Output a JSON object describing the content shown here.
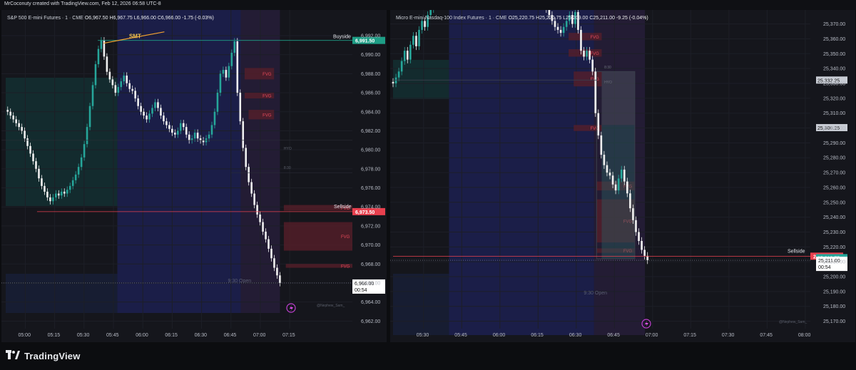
{
  "header": {
    "credit": "MrCoconuty created with TradingView.com, Feb 12, 2026 06:58 UTC-8"
  },
  "brand": {
    "name": "TradingView",
    "logo_icon": "tradingview-logo-icon"
  },
  "colors": {
    "up": "#26a69a",
    "down": "#f0f0f0",
    "buyside": "#1e9e86",
    "sellside": "#e8404e",
    "fvg": "#5a1f2a",
    "smt": "#f0a030",
    "session": "#1e2a66"
  },
  "chart_data": [
    {
      "type": "candlestick",
      "title": "S&P 500 E-mini Futures · 1 · CME",
      "ohlc_header": {
        "O": "6,967.50",
        "H": "6,967.75",
        "L": "6,966.00",
        "C": "6,966.00",
        "change": "-1.75 (-0.03%)"
      },
      "x_ticks": [
        "05:00",
        "05:15",
        "05:30",
        "05:45",
        "06:00",
        "06:15",
        "06:30",
        "06:45",
        "07:00",
        "07:15"
      ],
      "y_ticks": [
        "6,992.00",
        "6,990.00",
        "6,988.00",
        "6,986.00",
        "6,984.00",
        "6,982.00",
        "6,980.00",
        "6,978.00",
        "6,976.00",
        "6,974.00",
        "6,972.00",
        "6,970.00",
        "6,968.00",
        "6,966.00",
        "6,964.00",
        "6,962.00"
      ],
      "ylim": [
        6961.2,
        6993.2
      ],
      "xlim": [
        290,
        467
      ],
      "closes": [
        6984.0,
        6983.6,
        6983.2,
        6982.8,
        6982.4,
        6982.0,
        6981.2,
        6980.4,
        6979.6,
        6978.8,
        6978.0,
        6977.0,
        6976.2,
        6975.6,
        6975.0,
        6974.6,
        6975.0,
        6975.4,
        6975.2,
        6975.6,
        6975.4,
        6975.8,
        6976.2,
        6976.8,
        6977.4,
        6978.2,
        6979.2,
        6980.6,
        6982.4,
        6984.6,
        6986.8,
        6989.0,
        6990.6,
        6991.5,
        6989.8,
        6988.2,
        6987.4,
        6986.8,
        6986.0,
        6986.6,
        6987.2,
        6987.8,
        6987.0,
        6986.4,
        6986.2,
        6985.4,
        6984.6,
        6984.0,
        6983.6,
        6983.2,
        6983.8,
        6984.4,
        6985.0,
        6984.4,
        6983.6,
        6983.0,
        6982.6,
        6982.2,
        6981.8,
        6981.6,
        6982.0,
        6982.8,
        6982.4,
        6981.6,
        6981.0,
        6981.2,
        6981.8,
        6981.2,
        6981.0,
        6980.8,
        6981.2,
        6981.6,
        6982.6,
        6984.0,
        6986.0,
        6988.0,
        6988.4,
        6987.6,
        6988.8,
        6990.2,
        6991.4,
        6986.0,
        6983.0,
        6980.2,
        6978.2,
        6976.6,
        6975.4,
        6974.2,
        6973.2,
        6972.4,
        6971.4,
        6970.6,
        6969.6,
        6968.6,
        6967.6,
        6966.8,
        6966.0
      ],
      "annotations": {
        "smt": "SMT",
        "buyside": "Buyside",
        "sellside": "Sellside",
        "buyside_price": "6,991.50",
        "sellside_price": "6,973.50",
        "last_price": "6,966.00",
        "countdown": "00:54",
        "fvg_label": "FVG",
        "open1": "8:30 Open",
        "open2": "9:30 Open",
        "hyo": "HYO",
        "l830": "8:30",
        "watermark": "@Nephew_Sam_"
      },
      "levels": {
        "buyside": 6991.5,
        "sellside": 6973.5
      },
      "fvgs": [
        {
          "t0": 412,
          "t1": 427,
          "hi": 6988.6,
          "lo": 6987.4
        },
        {
          "t0": 412,
          "t1": 427,
          "hi": 6986.0,
          "lo": 6985.4
        },
        {
          "t0": 414,
          "t1": 427,
          "hi": 6984.2,
          "lo": 6983.2
        },
        {
          "t0": 432,
          "t1": 467,
          "hi": 6974.2,
          "lo": 6973.6
        },
        {
          "t0": 432,
          "t1": 467,
          "hi": 6972.4,
          "lo": 6969.4
        },
        {
          "t0": 433,
          "t1": 467,
          "hi": 6968.0,
          "lo": 6967.6
        }
      ]
    },
    {
      "type": "candlestick",
      "title": "Micro E-mini Nasdaq-100 Index Futures · 1 · CME",
      "ohlc_header": {
        "O": "25,220.75",
        "H": "25,220.75",
        "L": "25,209.00",
        "C": "25,211.00",
        "change": "-9.25 (-0.04%)"
      },
      "x_ticks": [
        "05:30",
        "05:45",
        "06:00",
        "06:15",
        "06:30",
        "06:45",
        "07:00",
        "07:15",
        "07:30",
        "07:45",
        "08:00"
      ],
      "y_ticks": [
        "25,370.00",
        "25,360.00",
        "25,350.00",
        "25,340.00",
        "25,330.00",
        "25,320.00",
        "25,310.00",
        "25,300.00",
        "25,290.00",
        "25,280.00",
        "25,270.00",
        "25,260.00",
        "25,250.00",
        "25,240.00",
        "25,230.00",
        "25,220.00",
        "25,210.00",
        "25,200.00",
        "25,190.00",
        "25,180.00",
        "25,170.00"
      ],
      "ylim": [
        25165.0,
        25377.0
      ],
      "xlim": [
        318,
        482
      ],
      "closes": [
        25330.0,
        25334.0,
        25338.0,
        25345.0,
        25352.0,
        25346.0,
        25356.0,
        25362.0,
        25355.0,
        25366.0,
        25372.0,
        25368.0,
        25376.0,
        25380.0,
        25384.0,
        25388.0,
        25392.0,
        25390.0,
        25388.0,
        25392.0,
        25395.0,
        25393.0,
        25390.0,
        25393.0,
        25396.0,
        25392.0,
        25388.0,
        25390.0,
        25393.0,
        25391.0,
        25389.0,
        25392.0,
        25395.0,
        25392.0,
        25389.0,
        25393.0,
        25397.0,
        25399.0,
        25397.0,
        25394.0,
        25396.0,
        25398.0,
        25395.0,
        25393.0,
        25390.0,
        25388.0,
        25391.0,
        25393.0,
        25390.0,
        25386.0,
        25388.0,
        25390.0,
        25386.0,
        25380.0,
        25376.0,
        25372.0,
        25368.0,
        25366.0,
        25364.0,
        25368.0,
        25372.0,
        25376.0,
        25370.0,
        25378.0,
        25366.0,
        25352.0,
        25348.0,
        25352.0,
        25346.0,
        25338.0,
        25310.0,
        25295.0,
        25282.0,
        25275.0,
        25270.0,
        25268.0,
        25262.0,
        25258.0,
        25266.0,
        25272.0,
        25264.0,
        25256.0,
        25246.0,
        25238.0,
        25230.0,
        25224.0,
        25218.0,
        25214.0,
        25211.0
      ],
      "annotations": {
        "sellside": "Sellside",
        "level_a": "25,332.25",
        "level_b": "25,300.25",
        "sellside_price": "25,213.75",
        "bid": "25,212.75",
        "last_price": "25,211.00",
        "countdown": "00:54",
        "fvg_label": "FVG",
        "open1": "8:30 Open",
        "open2": "9:30 Open",
        "hyo": "HYO",
        "l830": "8:30",
        "watermark": "@Nephew_Sam_"
      },
      "levels": {
        "sellside": 25213.75,
        "level_a": 25332.25,
        "level_b": 25300.25
      },
      "fvgs": [
        {
          "t0": 387,
          "t1": 400,
          "hi": 25364.0,
          "lo": 25359.0
        },
        {
          "t0": 387,
          "t1": 400,
          "hi": 25353.0,
          "lo": 25348.0
        },
        {
          "t0": 389,
          "t1": 400,
          "hi": 25338.0,
          "lo": 25328.0
        },
        {
          "t0": 389,
          "t1": 400,
          "hi": 25302.0,
          "lo": 25298.0
        },
        {
          "t0": 398,
          "t1": 413,
          "hi": 25264.0,
          "lo": 25258.0
        },
        {
          "t0": 398,
          "t1": 413,
          "hi": 25252.0,
          "lo": 25223.0
        },
        {
          "t0": 398,
          "t1": 413,
          "hi": 25219.0,
          "lo": 25216.0
        }
      ]
    }
  ]
}
